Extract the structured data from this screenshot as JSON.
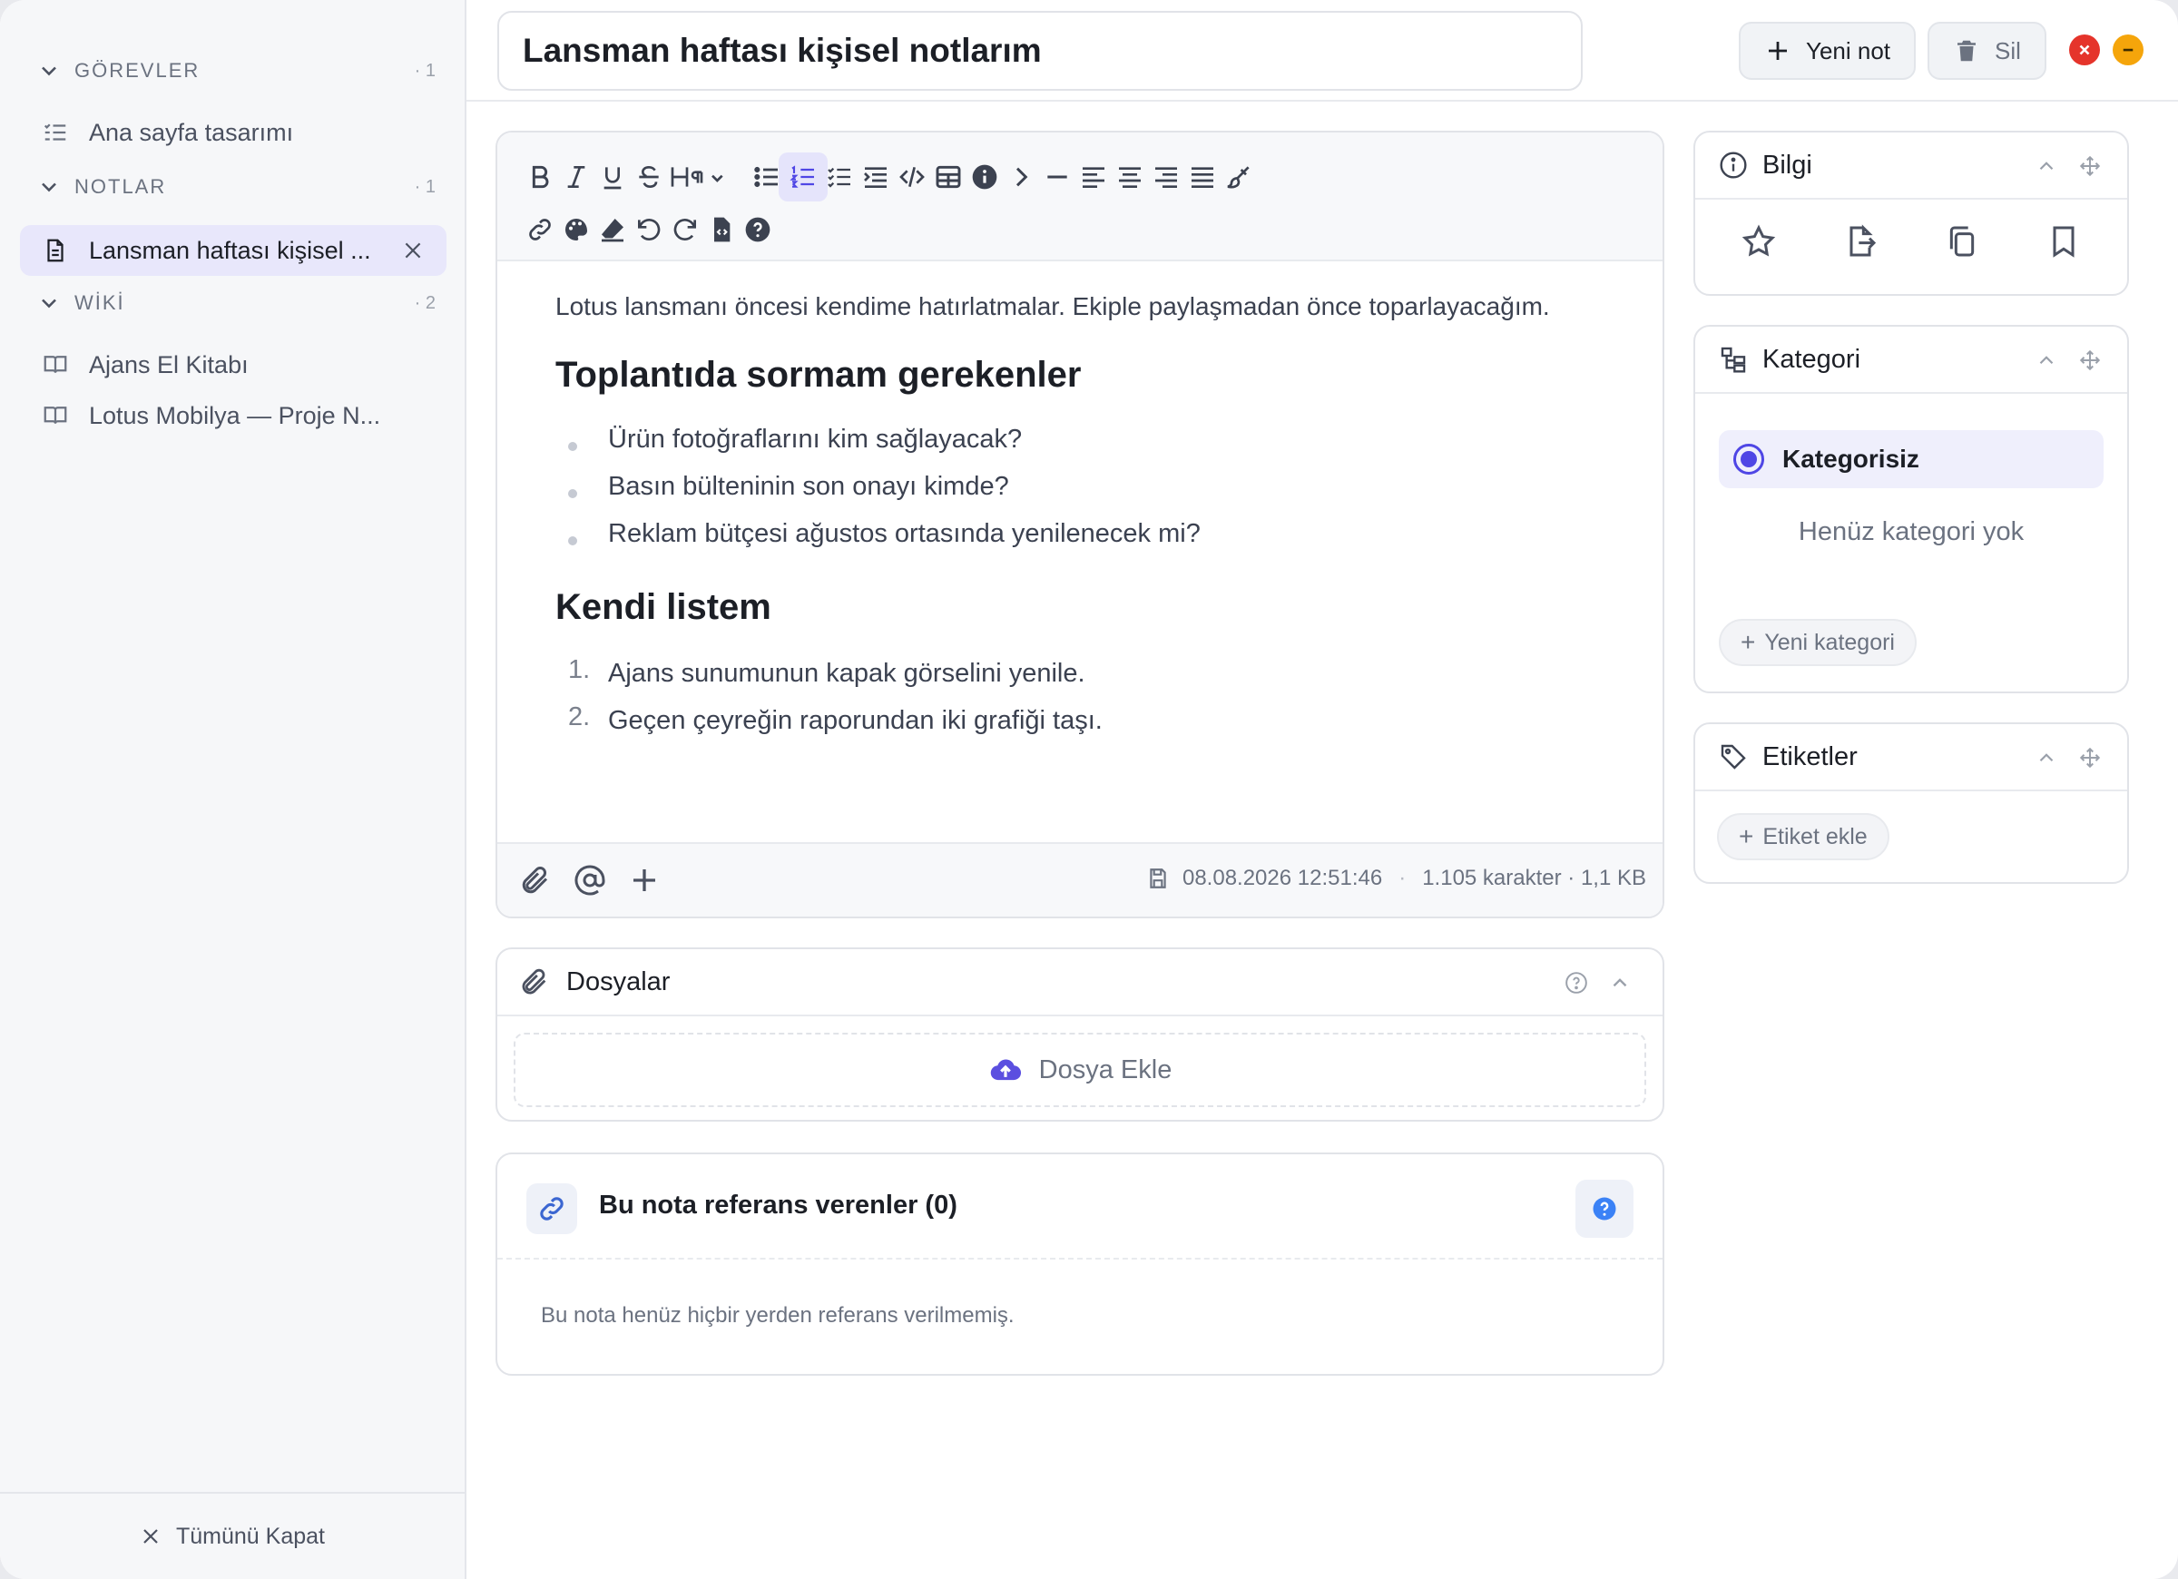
{
  "sidebar": {
    "sections": [
      {
        "label": "GÖREVLER",
        "count": "· 1"
      },
      {
        "label": "NOTLAR",
        "count": "· 1"
      },
      {
        "label": "WİKİ",
        "count": "· 2"
      }
    ],
    "items": [
      {
        "label": "Ana sayfa tasarımı",
        "icon": "tasklist-icon"
      },
      {
        "label": "Lansman haftası kişisel ...",
        "icon": "document-icon"
      },
      {
        "label": "Ajans El Kitabı",
        "icon": "book-icon"
      },
      {
        "label": "Lotus Mobilya — Proje N...",
        "icon": "book-icon"
      }
    ],
    "close_all": "Tümünü Kapat"
  },
  "header": {
    "title_value": "Lansman haftası kişisel notlarım",
    "new_note": "Yeni not",
    "delete": "Sil"
  },
  "editor": {
    "lead": "Lotus lansmanı öncesi kendime hatırlatmalar. Ekiple paylaşmadan önce toparlayacağım.",
    "heading1": "Toplantıda sormam gerekenler",
    "bullets": [
      "Ürün fotoğraflarını kim sağlayacak?",
      "Basın bülteninin son onayı kimde?",
      "Reklam bütçesi ağustos ortasında yenilenecek mi?"
    ],
    "heading2": "Kendi listem",
    "ordered": [
      {
        "n": "1.",
        "text": "Ajans sunumunun kapak görselini yenile."
      },
      {
        "n": "2.",
        "text": "Geçen çeyreğin raporundan iki grafiği taşı."
      }
    ],
    "saved_at": "08.08.2026 12:51:46",
    "separator": "·",
    "stats": "1.105 karakter · 1,1 KB"
  },
  "files": {
    "title": "Dosyalar",
    "add": "Dosya Ekle"
  },
  "refs": {
    "title": "Bu nota referans verenler (0)",
    "empty": "Bu nota henüz hiçbir yerden referans verilmemiş."
  },
  "panels": {
    "info": {
      "title": "Bilgi"
    },
    "category": {
      "title": "Kategori",
      "selected": "Kategorisiz",
      "empty": "Henüz kategori yok",
      "new": "Yeni kategori"
    },
    "tags": {
      "title": "Etiketler",
      "add": "Etiket ekle"
    }
  },
  "colors": {
    "accent": "#4f46e5",
    "close_dot": "#e5342b",
    "minimize_dot": "#f5a50b",
    "help_blue": "#3b82f6"
  }
}
